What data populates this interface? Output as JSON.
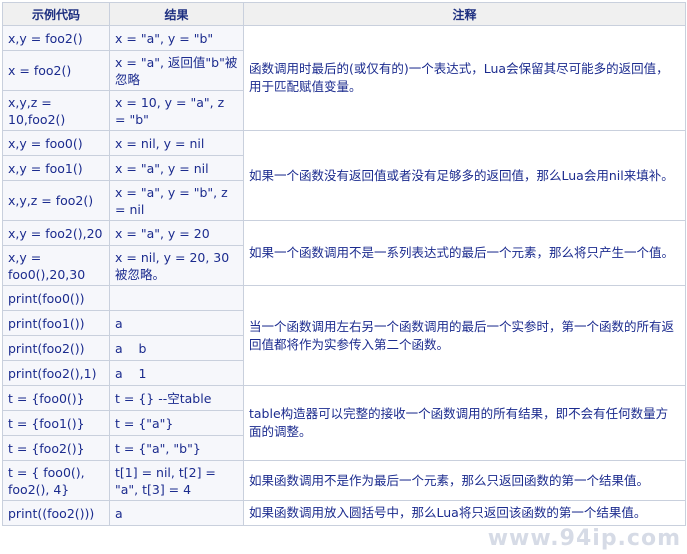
{
  "headers": [
    "示例代码",
    "结果",
    "注释"
  ],
  "rows": [
    {
      "code": "x,y = foo2()",
      "result": "x = \"a\", y = \"b\""
    },
    {
      "code": "x = foo2()",
      "result": "x = \"a\", 返回值\"b\"被忽略"
    },
    {
      "code": "x,y,z = 10,foo2()",
      "result": "x = 10, y = \"a\", z = \"b\""
    },
    {
      "code": "x,y = foo0()",
      "result": "x = nil, y = nil"
    },
    {
      "code": "x,y = foo1()",
      "result": "x = \"a\", y = nil"
    },
    {
      "code": "x,y,z = foo2()",
      "result": "x = \"a\", y = \"b\", z = nil"
    },
    {
      "code": "x,y = foo2(),20",
      "result": "x = \"a\", y = 20"
    },
    {
      "code": "x,y = foo0(),20,30",
      "result": "x = nil, y = 20, 30被忽略。"
    },
    {
      "code": "print(foo0())",
      "result": ""
    },
    {
      "code": "print(foo1())",
      "result": "a"
    },
    {
      "code": "print(foo2())",
      "result": "a    b"
    },
    {
      "code": "print(foo2(),1)",
      "result": "a    1"
    },
    {
      "code": "t = {foo0()}",
      "result": "t = {} --空table"
    },
    {
      "code": "t = {foo1()}",
      "result": "t = {\"a\"}"
    },
    {
      "code": "t = {foo2()}",
      "result": "t = {\"a\", \"b\"}"
    },
    {
      "code": "t = { foo0(), foo2(), 4}",
      "result": "t[1] = nil, t[2] = \"a\", t[3] = 4"
    },
    {
      "code": "print((foo2()))",
      "result": "a"
    }
  ],
  "notes": [
    "函数调用时最后的(或仅有的)一个表达式，Lua会保留其尽可能多的返回值，用于匹配赋值变量。",
    "如果一个函数没有返回值或者没有足够多的返回值，那么Lua会用nil来填补。",
    "如果一个函数调用不是一系列表达式的最后一个元素，那么将只产生一个值。",
    "当一个函数调用左右另一个函数调用的最后一个实参时，第一个函数的所有返回值都将作为实参传入第二个函数。",
    "table构造器可以完整的接收一个函数调用的所有结果，即不会有任何数量方面的调整。",
    "如果函数调用不是作为最后一个元素，那么只返回函数的第一个结果值。",
    "如果函数调用放入圆括号中，那么Lua将只返回该函数的第一个结果值。"
  ],
  "watermark": "www.94ip.com"
}
